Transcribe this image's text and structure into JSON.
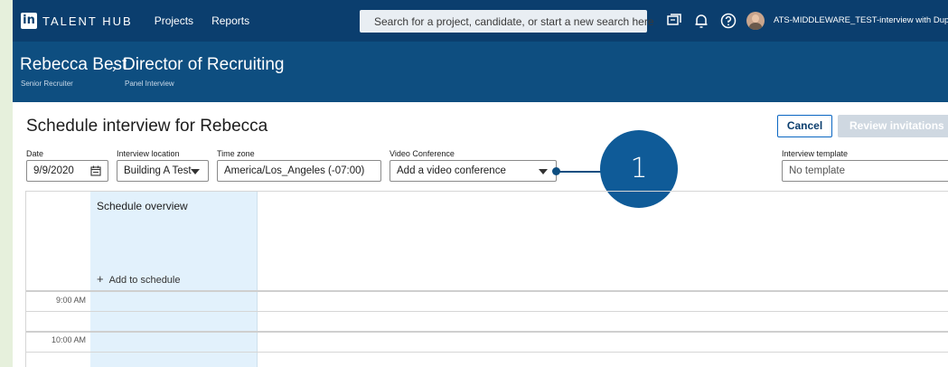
{
  "nav": {
    "logo": "in",
    "brand": "TALENT HUB",
    "links": [
      "Projects",
      "Reports"
    ],
    "search_placeholder": "Search for a project, candidate, or start a new search here",
    "account": "ATS-MIDDLEWARE_TEST-interview with Duplo"
  },
  "header": {
    "candidate_name": "Rebecca Best",
    "candidate_role": "Senior Recruiter",
    "job_title": "Director of Recruiting",
    "job_subtitle": "Panel Interview",
    "separator": "›"
  },
  "page": {
    "title": "Schedule interview for Rebecca",
    "cancel_label": "Cancel",
    "review_label": "Review invitations"
  },
  "form": {
    "date_label": "Date",
    "date_value": "9/9/2020",
    "location_label": "Interview location",
    "location_value": "Building A Test",
    "timezone_label": "Time zone",
    "timezone_value": "America/Los_Angeles (-07:00)",
    "video_label": "Video Conference",
    "video_value": "Add a video conference",
    "template_label": "Interview template",
    "template_value": "No template"
  },
  "callout": {
    "number": "1"
  },
  "schedule": {
    "overview_title": "Schedule overview",
    "add_label": "Add to schedule",
    "add_icon": "+",
    "times": [
      "9:00 AM",
      "10:00 AM"
    ]
  },
  "colors": {
    "nav_bg": "#0b3e6e",
    "header_bg": "#0e4e80",
    "accent": "#0a66c2",
    "overview_bg": "#e2f1fc",
    "callout": "#0f5b98"
  }
}
